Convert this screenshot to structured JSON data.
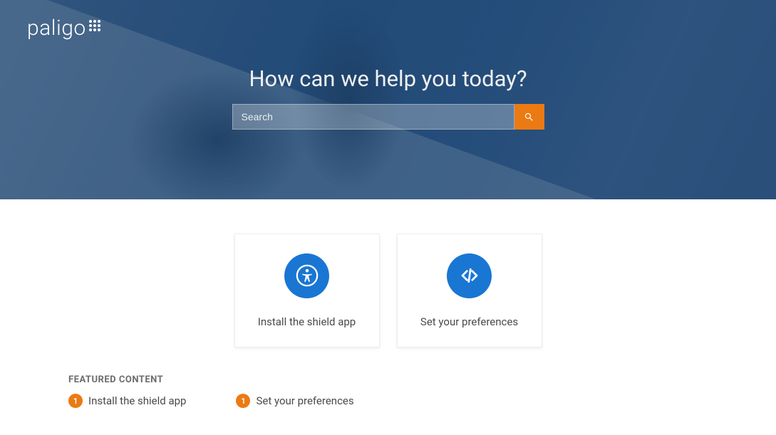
{
  "brand": {
    "name": "paligo"
  },
  "hero": {
    "title": "How can we help you today?",
    "search_placeholder": "Search"
  },
  "cards": [
    {
      "icon": "accessibility",
      "label": "Install the shield app"
    },
    {
      "icon": "code",
      "label": "Set your preferences"
    }
  ],
  "featured": {
    "heading": "FEATURED CONTENT",
    "items": [
      {
        "badge": "1",
        "label": "Install the shield app"
      },
      {
        "badge": "1",
        "label": "Set your preferences"
      }
    ]
  },
  "colors": {
    "accent_orange": "#ec7a13",
    "accent_blue": "#1976d2",
    "hero_overlay": "#2f5880"
  }
}
